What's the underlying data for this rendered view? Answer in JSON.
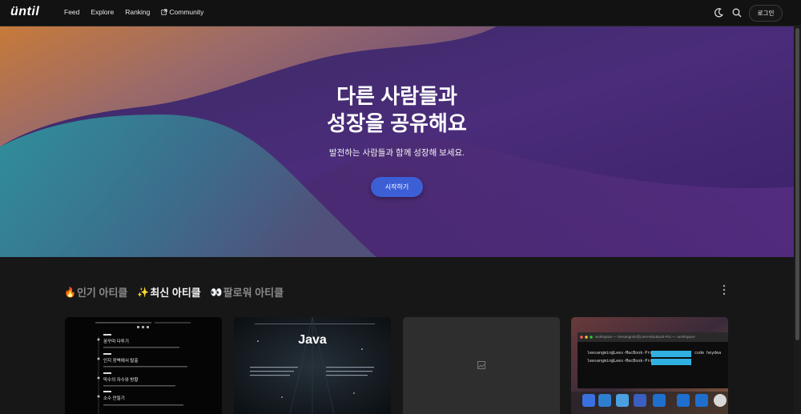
{
  "header": {
    "logo": "üntil",
    "nav": [
      "Feed",
      "Explore",
      "Ranking",
      "Community"
    ],
    "community_icon": "external-link-icon",
    "icons": [
      "moon-icon",
      "search-icon"
    ],
    "login_label": "로그인"
  },
  "hero": {
    "title_line1": "다른 사람들과",
    "title_line2": "성장을 공유해요",
    "subtitle": "발전하는 사람들과 함께 성장해 보세요.",
    "cta_label": "시작하기"
  },
  "feed": {
    "tabs": [
      {
        "emoji": "🔥",
        "label": "인기 아티클",
        "active": false
      },
      {
        "emoji": "✨",
        "label": "최신 아티클",
        "active": true
      },
      {
        "emoji": "👀",
        "label": "팔로워 아티클",
        "active": false
      }
    ],
    "more_icon": "kebab-menu-icon"
  },
  "cards": [
    {
      "thumb": "timeline-screenshot",
      "items": [
        "꿈꾸며 다투기",
        "인지 장벽에서 탈출",
        "막수의 자수와 방황",
        "소수 만들기"
      ]
    },
    {
      "thumb": "java-space-banner",
      "heading": "Java"
    },
    {
      "thumb": "image-placeholder",
      "icon": "image-icon"
    },
    {
      "thumb": "macos-terminal-screenshot",
      "window_title": "workspace — leesangmin@Lees-MacBook-Pro — -workspace",
      "prompt": "leesangmin@Lees-MacBook-Pro",
      "command": "code heydea"
    }
  ]
}
